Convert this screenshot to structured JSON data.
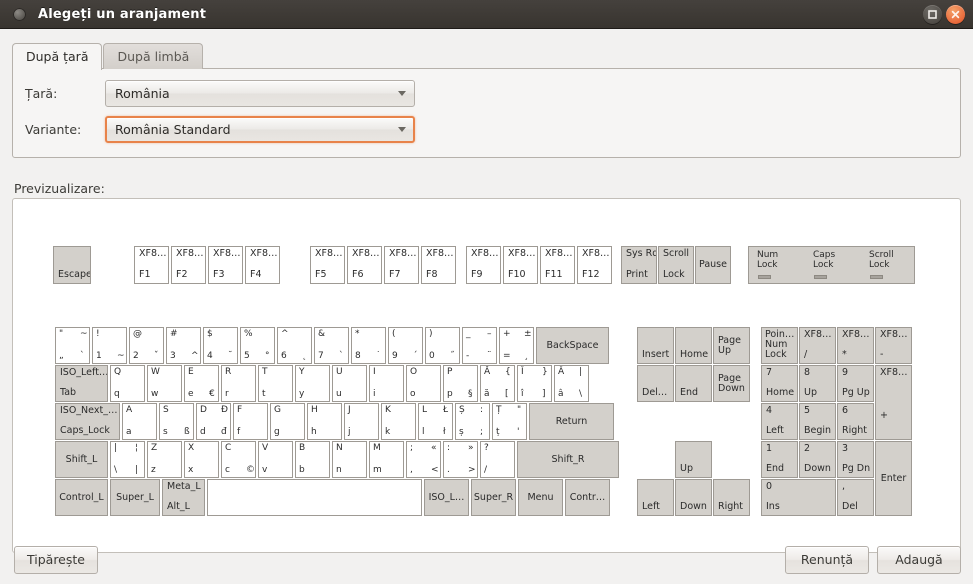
{
  "window": {
    "title": "Alegeți un aranjament",
    "maximize_label": "Maximizează",
    "close_label": "Închide"
  },
  "tabs": [
    {
      "label": "După țară",
      "active": true
    },
    {
      "label": "După limbă",
      "active": false
    }
  ],
  "form": {
    "country_label": "Țară:",
    "country_value": "România",
    "variant_label": "Variante:",
    "variant_value": "România Standard"
  },
  "preview": {
    "label": "Previzualizare:"
  },
  "footer": {
    "print_label": "Tipărește",
    "cancel_label": "Renunță",
    "add_label": "Adaugă"
  },
  "keyboard": {
    "esc": {
      "name": "Escape"
    },
    "fkeys_1": [
      {
        "top": "XF8…",
        "bottom": "F1"
      },
      {
        "top": "XF8…",
        "bottom": "F2"
      },
      {
        "top": "XF8…",
        "bottom": "F3"
      },
      {
        "top": "XF8…",
        "bottom": "F4"
      }
    ],
    "fkeys_2": [
      {
        "top": "XF8…",
        "bottom": "F5"
      },
      {
        "top": "XF8…",
        "bottom": "F6"
      },
      {
        "top": "XF8…",
        "bottom": "F7"
      },
      {
        "top": "XF8…",
        "bottom": "F8"
      }
    ],
    "fkeys_3": [
      {
        "top": "XF8…",
        "bottom": "F9"
      },
      {
        "top": "XF8…",
        "bottom": "F10"
      },
      {
        "top": "XF8…",
        "bottom": "F11"
      },
      {
        "top": "XF8…",
        "bottom": "F12"
      }
    ],
    "sysblock": [
      {
        "top": "Sys Rq",
        "bottom": "Print"
      },
      {
        "top": "Scroll",
        "bottom": "Lock"
      },
      {
        "top": "",
        "bottom": "Pause"
      }
    ],
    "leds": [
      {
        "l1": "Num",
        "l2": "Lock"
      },
      {
        "l1": "Caps",
        "l2": "Lock"
      },
      {
        "l1": "Scroll",
        "l2": "Lock"
      }
    ],
    "row_number": [
      {
        "tl": "\"",
        "tr": "~",
        "bl": "„",
        "br": "`"
      },
      {
        "tl": "!",
        "tr": "",
        "bl": "1",
        "br": "~"
      },
      {
        "tl": "@",
        "tr": "",
        "bl": "2",
        "br": "ˇ"
      },
      {
        "tl": "#",
        "tr": "",
        "bl": "3",
        "br": "^"
      },
      {
        "tl": "$",
        "tr": "",
        "bl": "4",
        "br": "˘"
      },
      {
        "tl": "%",
        "tr": "",
        "bl": "5",
        "br": "°"
      },
      {
        "tl": "^",
        "tr": "",
        "bl": "6",
        "br": "˛"
      },
      {
        "tl": "&",
        "tr": "",
        "bl": "7",
        "br": "`"
      },
      {
        "tl": "*",
        "tr": "",
        "bl": "8",
        "br": "˙"
      },
      {
        "tl": "(",
        "tr": "",
        "bl": "9",
        "br": "´"
      },
      {
        "tl": ")",
        "tr": "",
        "bl": "0",
        "br": "˝"
      },
      {
        "tl": "_",
        "tr": "–",
        "bl": "-",
        "br": "¨"
      },
      {
        "tl": "+",
        "tr": "±",
        "bl": "=",
        "br": "¸"
      }
    ],
    "backspace": {
      "name": "BackSpace"
    },
    "tab": {
      "top": "ISO_Left…",
      "bottom": "Tab"
    },
    "row_q": [
      {
        "tl": "Q",
        "tr": "",
        "bl": "q",
        "br": ""
      },
      {
        "tl": "W",
        "tr": "",
        "bl": "w",
        "br": ""
      },
      {
        "tl": "E",
        "tr": "",
        "bl": "e",
        "br": "€"
      },
      {
        "tl": "R",
        "tr": "",
        "bl": "r",
        "br": ""
      },
      {
        "tl": "T",
        "tr": "",
        "bl": "t",
        "br": ""
      },
      {
        "tl": "Y",
        "tr": "",
        "bl": "y",
        "br": ""
      },
      {
        "tl": "U",
        "tr": "",
        "bl": "u",
        "br": ""
      },
      {
        "tl": "I",
        "tr": "",
        "bl": "i",
        "br": ""
      },
      {
        "tl": "O",
        "tr": "",
        "bl": "o",
        "br": ""
      },
      {
        "tl": "P",
        "tr": "",
        "bl": "p",
        "br": "§"
      },
      {
        "tl": "Ă",
        "tr": "{",
        "bl": "ă",
        "br": "["
      },
      {
        "tl": "Î",
        "tr": "}",
        "bl": "î",
        "br": "]"
      },
      {
        "tl": "Â",
        "tr": "|",
        "bl": "â",
        "br": "\\"
      }
    ],
    "caps": {
      "top": "ISO_Next_…",
      "bottom": "Caps_Lock"
    },
    "row_a": [
      {
        "tl": "A",
        "tr": "",
        "bl": "a",
        "br": ""
      },
      {
        "tl": "S",
        "tr": "",
        "bl": "s",
        "br": "ß"
      },
      {
        "tl": "D",
        "tr": "Đ",
        "bl": "d",
        "br": "đ"
      },
      {
        "tl": "F",
        "tr": "",
        "bl": "f",
        "br": ""
      },
      {
        "tl": "G",
        "tr": "",
        "bl": "g",
        "br": ""
      },
      {
        "tl": "H",
        "tr": "",
        "bl": "h",
        "br": ""
      },
      {
        "tl": "J",
        "tr": "",
        "bl": "j",
        "br": ""
      },
      {
        "tl": "K",
        "tr": "",
        "bl": "k",
        "br": ""
      },
      {
        "tl": "L",
        "tr": "Ł",
        "bl": "l",
        "br": "ł"
      },
      {
        "tl": "Ș",
        "tr": ":",
        "bl": "ș",
        "br": ";"
      },
      {
        "tl": "Ț",
        "tr": "\"",
        "bl": "ț",
        "br": "'"
      }
    ],
    "return": {
      "name": "Return"
    },
    "shift_l": {
      "name": "Shift_L"
    },
    "row_z": [
      {
        "tl": "|",
        "tr": "¦",
        "bl": "\\",
        "br": "|"
      },
      {
        "tl": "Z",
        "tr": "",
        "bl": "z",
        "br": ""
      },
      {
        "tl": "X",
        "tr": "",
        "bl": "x",
        "br": ""
      },
      {
        "tl": "C",
        "tr": "",
        "bl": "c",
        "br": "©"
      },
      {
        "tl": "V",
        "tr": "",
        "bl": "v",
        "br": ""
      },
      {
        "tl": "B",
        "tr": "",
        "bl": "b",
        "br": ""
      },
      {
        "tl": "N",
        "tr": "",
        "bl": "n",
        "br": ""
      },
      {
        "tl": "M",
        "tr": "",
        "bl": "m",
        "br": ""
      },
      {
        "tl": ";",
        "tr": "«",
        "bl": ",",
        "br": "<"
      },
      {
        "tl": ":",
        "tr": "»",
        "bl": ".",
        "br": ">"
      },
      {
        "tl": "?",
        "tr": "",
        "bl": "/",
        "br": ""
      }
    ],
    "shift_r": {
      "name": "Shift_R"
    },
    "bottom_row": [
      {
        "name": "Control_L"
      },
      {
        "name": "Super_L"
      },
      {
        "top": "Meta_L",
        "bottom": "Alt_L"
      },
      {
        "name": ""
      },
      {
        "name": "ISO_L…"
      },
      {
        "name": "Super_R"
      },
      {
        "name": "Menu"
      },
      {
        "name": "Contr…"
      }
    ],
    "nav_block": [
      {
        "name": "Insert"
      },
      {
        "name": "Home"
      },
      {
        "l1": "Page",
        "l2": "Up"
      },
      {
        "name": "Del…"
      },
      {
        "name": "End"
      },
      {
        "l1": "Page",
        "l2": "Down"
      }
    ],
    "arrows": [
      {
        "name": "Up"
      },
      {
        "name": "Left"
      },
      {
        "name": "Down"
      },
      {
        "name": "Right"
      }
    ],
    "numpad": [
      {
        "tl": "Poin…",
        "t2": "Num",
        "t3": "Lock"
      },
      {
        "top": "XF8…",
        "bottom": "/"
      },
      {
        "top": "XF8…",
        "bottom": "*"
      },
      {
        "top": "XF8…",
        "bottom": "-"
      },
      {
        "top": "7",
        "bottom": "Home"
      },
      {
        "top": "8",
        "bottom": "Up"
      },
      {
        "top": "9",
        "bottom": "Pg Up"
      },
      {
        "top": "XF8…",
        "bottom": "+"
      },
      {
        "top": "4",
        "bottom": "Left"
      },
      {
        "top": "5",
        "bottom": "Begin"
      },
      {
        "top": "6",
        "bottom": "Right"
      },
      {
        "top": "1",
        "bottom": "End"
      },
      {
        "top": "2",
        "bottom": "Down"
      },
      {
        "top": "3",
        "bottom": "Pg Dn"
      },
      {
        "top": "0",
        "bottom": "Ins"
      },
      {
        "top": ",",
        "bottom": "Del"
      },
      {
        "name": "Enter"
      }
    ]
  }
}
